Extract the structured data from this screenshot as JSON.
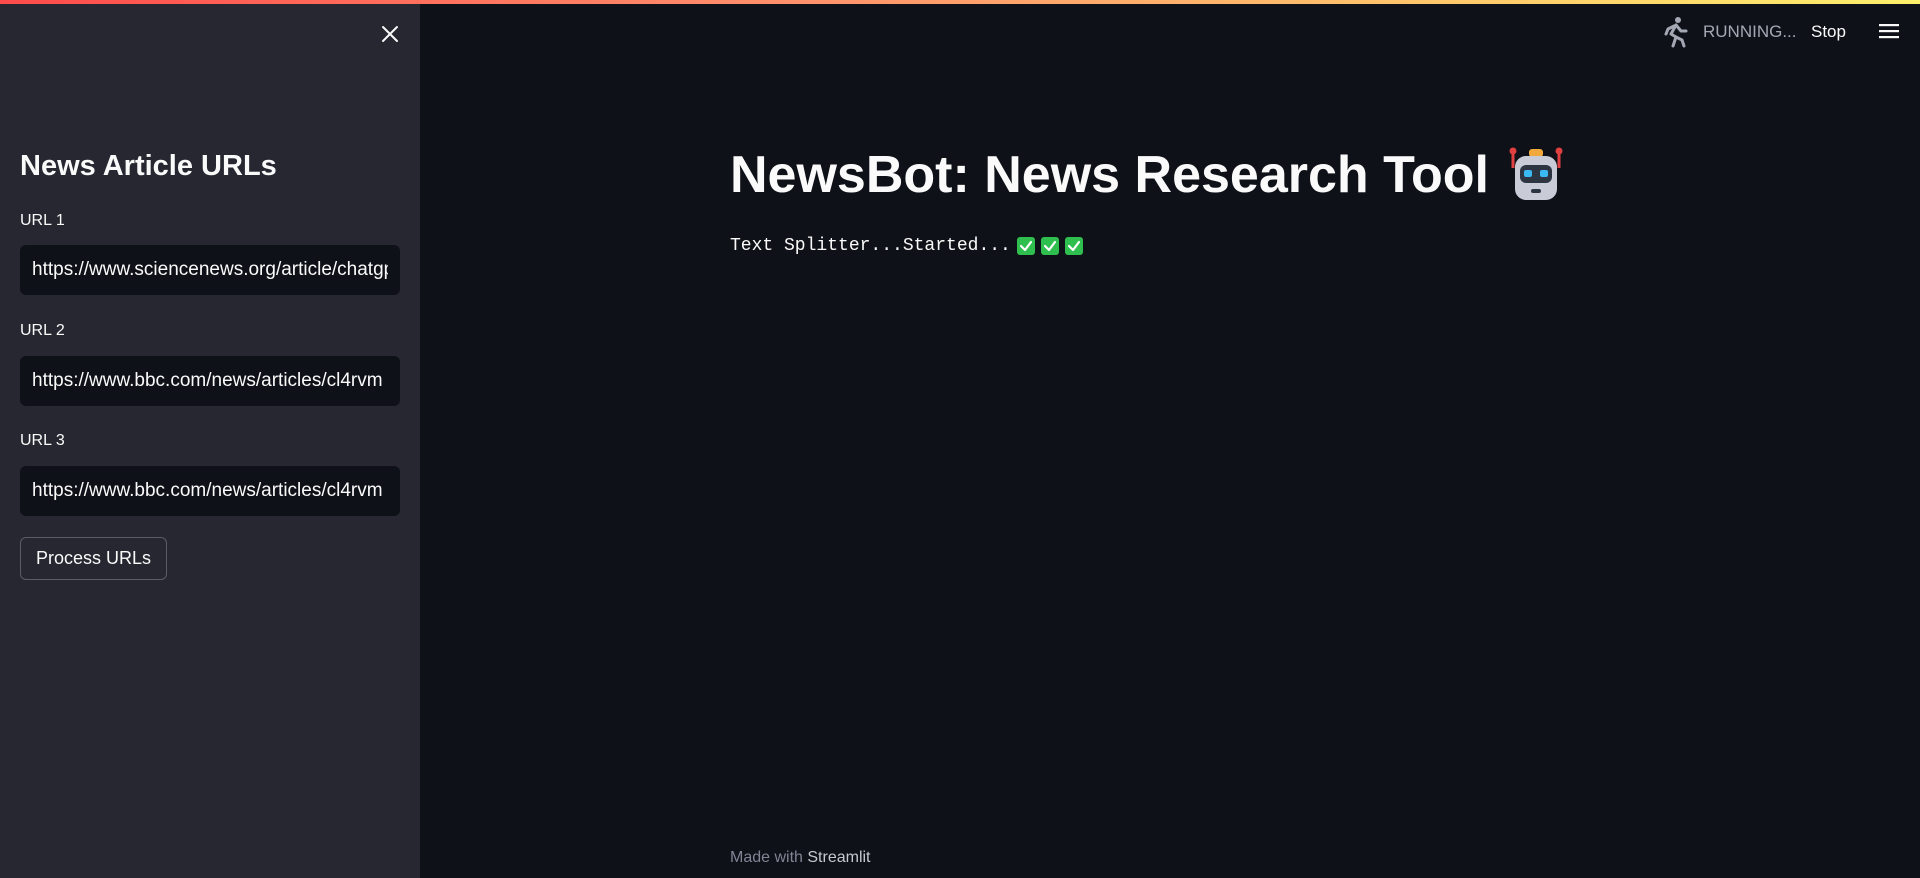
{
  "sidebar": {
    "close_icon": "close-icon",
    "title": "News Article URLs",
    "fields": [
      {
        "label": "URL 1",
        "value": "https://www.sciencenews.org/article/chatgpt-ai-artificial-intelligence-education-cheating-accuracy"
      },
      {
        "label": "URL 2",
        "value": "https://www.bbc.com/news/articles/cl4rvm"
      },
      {
        "label": "URL 3",
        "value": "https://www.bbc.com/news/articles/cl4rvm"
      }
    ],
    "process_button_label": "Process URLs"
  },
  "header": {
    "running_icon": "running-person-icon",
    "status_text": "RUNNING...",
    "stop_label": "Stop",
    "menu_icon": "hamburger-menu-icon"
  },
  "main": {
    "title": "NewsBot: News Research Tool",
    "title_icon": "robot-icon",
    "status_text": "Text Splitter...Started...",
    "status_checks": [
      "check-icon",
      "check-icon",
      "check-icon"
    ]
  },
  "footer": {
    "prefix": "Made with",
    "brand": "Streamlit"
  },
  "colors": {
    "background": "#0e1117",
    "sidebar": "#262730",
    "text": "#fafafa",
    "check_green": "#2fbf4f",
    "accent_gradient_start": "#ff4b4b",
    "accent_gradient_end": "#fdf06b"
  }
}
